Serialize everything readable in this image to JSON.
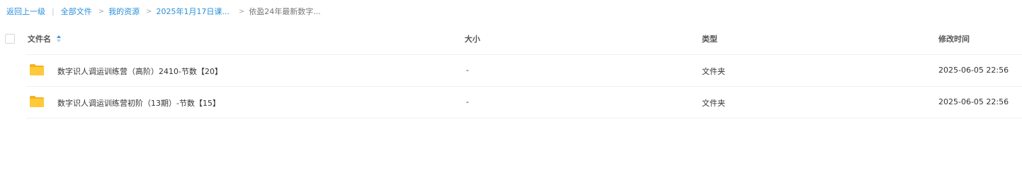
{
  "breadcrumb": {
    "back": "返回上一级",
    "items": [
      "全部文件",
      "我的资源",
      "2025年1月17日课..."
    ],
    "current": "依盈24年最新数字..."
  },
  "table": {
    "columns": {
      "name": "文件名",
      "size": "大小",
      "type": "类型",
      "modified": "修改时间"
    },
    "sort_icon": "sort-ascending-icon",
    "rows": [
      {
        "icon": "folder-icon",
        "name": "数字识人调运训练营（高阶）2410-节数【20】",
        "size": "-",
        "type": "文件夹",
        "modified": "2025-06-05 22:56"
      },
      {
        "icon": "folder-icon",
        "name": "数字识人调运训练营初阶（13期）-节数【15】",
        "size": "-",
        "type": "文件夹",
        "modified": "2025-06-05 22:56"
      }
    ]
  },
  "colors": {
    "link": "#2a8fd9",
    "folder": "#ffc93a",
    "folder_tab": "#f4b223"
  }
}
